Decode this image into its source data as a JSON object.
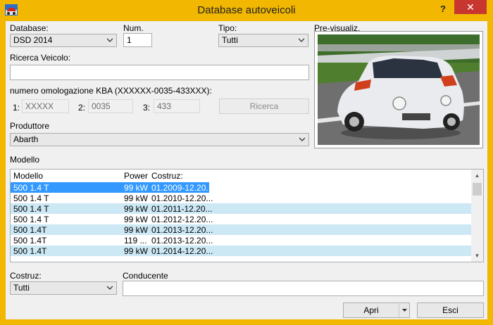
{
  "window": {
    "title": "Database autoveicoli",
    "help_label": "?",
    "close_label": "✕",
    "accent_color": "#f2b700"
  },
  "database": {
    "label": "Database:",
    "value": "DSD 2014"
  },
  "num": {
    "label": "Num.",
    "value": "1"
  },
  "tipo": {
    "label": "Tipo:",
    "value": "Tutti"
  },
  "preview": {
    "label": "Pre-visualiz."
  },
  "ricerca_veicolo": {
    "label": "Ricerca Veicolo:",
    "value": ""
  },
  "kba": {
    "label": "numero omologazione KBA (XXXXXX-0035-433XXX):",
    "field1_label": "1:",
    "field1_value": "XXXXX",
    "field2_label": "2:",
    "field2_value": "0035",
    "field3_label": "3:",
    "field3_value": "433",
    "search_button": "Ricerca"
  },
  "produttore": {
    "label": "Produttore",
    "value": "Abarth"
  },
  "modello": {
    "label": "Modello",
    "columns": [
      "Modello",
      "Power",
      "Costruz:"
    ],
    "rows": [
      {
        "model": "500 1.4 T",
        "power": "99 kW",
        "costruz": "01.2009-12.20...",
        "selected": true
      },
      {
        "model": "500 1.4 T",
        "power": "99 kW",
        "costruz": "01.2010-12.20..."
      },
      {
        "model": "500 1.4 T",
        "power": "99 kW",
        "costruz": "01.2011-12.20..."
      },
      {
        "model": "500 1.4 T",
        "power": "99 kW",
        "costruz": "01.2012-12.20..."
      },
      {
        "model": "500 1.4T",
        "power": "99 kW",
        "costruz": "01.2013-12.20..."
      },
      {
        "model": "500 1.4T",
        "power": "119 ...",
        "costruz": "01.2013-12.20..."
      },
      {
        "model": "500 1.4T",
        "power": "99 kW",
        "costruz": "01.2014-12.20..."
      }
    ],
    "selection_color": "#3399ff",
    "alt_row_color": "#cce8f5"
  },
  "costruz": {
    "label": "Costruz:",
    "value": "Tutti"
  },
  "conducente": {
    "label": "Conducente",
    "value": ""
  },
  "buttons": {
    "open": "Apri",
    "close": "Esci"
  },
  "icons": {
    "app": "app-icon",
    "chevron": "chevron-down-icon",
    "scroll_up": "scroll-up-icon",
    "scroll_down": "scroll-down-icon"
  }
}
